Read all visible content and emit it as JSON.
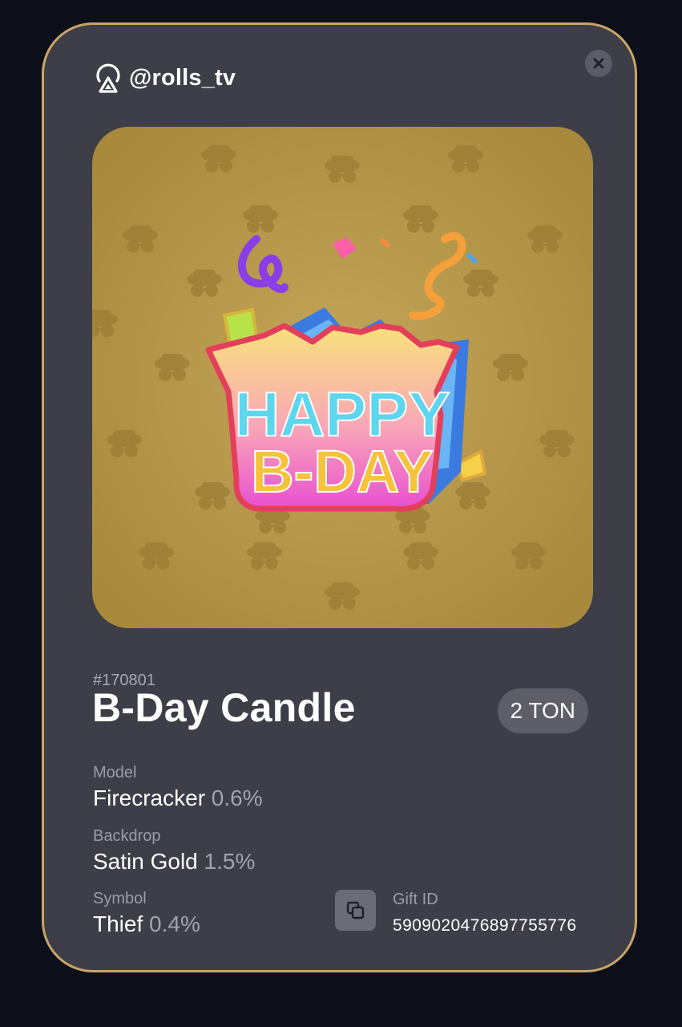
{
  "header": {
    "handle": "@rolls_tv",
    "logo_icon": "signal-triangle-icon",
    "close_icon": "close-icon"
  },
  "artwork": {
    "background_color": "#b49648",
    "badge_text_line1": "HAPPY",
    "badge_text_line2": "B-DAY"
  },
  "gift": {
    "number": "#170801",
    "title": "B-Day Candle",
    "price": "2 TON"
  },
  "attributes": {
    "model": {
      "label": "Model",
      "value": "Firecracker",
      "percent": "0.6%"
    },
    "backdrop": {
      "label": "Backdrop",
      "value": "Satin Gold",
      "percent": "1.5%"
    },
    "symbol": {
      "label": "Symbol",
      "value": "Thief",
      "percent": "0.4%"
    }
  },
  "gift_id": {
    "label": "Gift ID",
    "value": "5909020476897755776",
    "copy_icon": "copy-icon"
  },
  "colors": {
    "card_bg": "#3d3e47",
    "card_border": "#c9a566",
    "page_bg": "#0c0f1a"
  }
}
